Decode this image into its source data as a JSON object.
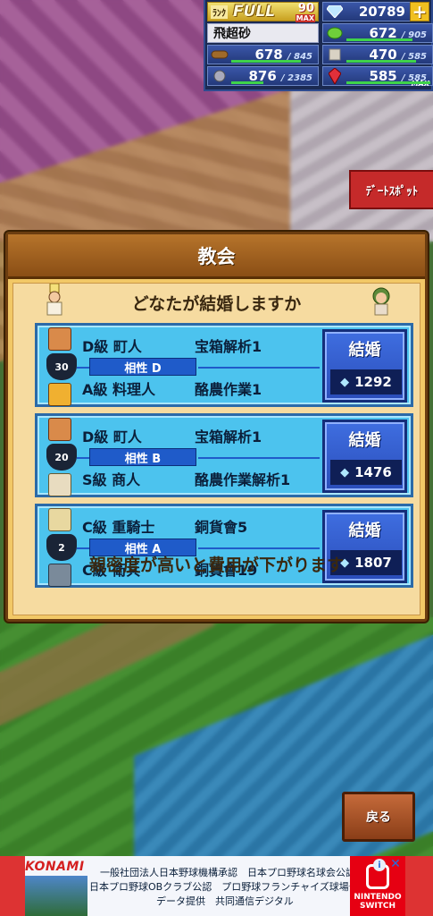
{
  "status": {
    "rank_label": "ﾗﾝｸ",
    "rank_full": "FULL",
    "rank_level": "90",
    "rank_max": "MAX",
    "gems": "20789",
    "town_name": "飛超砂",
    "resources": [
      {
        "icon": "grass-icon",
        "value": "672",
        "max": "905",
        "fill": 0.74
      },
      {
        "icon": "wood-icon",
        "value": "678",
        "max": "845",
        "fill": 0.8
      },
      {
        "icon": "food-icon",
        "value": "470",
        "max": "585",
        "fill": 0.8
      },
      {
        "icon": "ore-icon",
        "value": "876",
        "max": "2385",
        "fill": 0.37
      },
      {
        "icon": "ruby-icon",
        "value": "585",
        "max": "585",
        "fill": 1.0
      }
    ],
    "ruby_max_label": "MAX",
    "colors": {
      "bar": "#3fd34a",
      "panel": "#1b2a52"
    }
  },
  "date_spot": "ﾃﾞｰﾄｽﾎﾟｯﾄ",
  "dialog": {
    "title": "教会",
    "question": "どなたが結婚しますか",
    "hint": "親密度が高いと費用が下がります",
    "couples": [
      {
        "person1": {
          "rank": "D級",
          "job": "町人",
          "skill": "宝箱解析1"
        },
        "person2": {
          "rank": "A級",
          "job": "料理人",
          "skill": "酪農作業1"
        },
        "intimacy": "30",
        "compat": "相性 D",
        "button": "結婚",
        "cost": "1292"
      },
      {
        "person1": {
          "rank": "D級",
          "job": "町人",
          "skill": "宝箱解析1"
        },
        "person2": {
          "rank": "S級",
          "job": "商人",
          "skill": "酪農作業解析1"
        },
        "intimacy": "20",
        "compat": "相性 B",
        "button": "結婚",
        "cost": "1476"
      },
      {
        "person1": {
          "rank": "C級",
          "job": "重騎士",
          "skill": "銅貨會5"
        },
        "person2": {
          "rank": "C級",
          "job": "衛兵",
          "skill": "銅貨會19"
        },
        "intimacy": "2",
        "compat": "相性 A",
        "button": "結婚",
        "cost": "1807"
      }
    ]
  },
  "back_button": "戻る",
  "ad": {
    "brand": "KONAMI",
    "line1": "一般社団法人日本野球機構承認　日本プロ野球名球会公認",
    "line2": "日本プロ野球OBクラブ公認　プロ野球フランチャイズ球場公認",
    "line3": "データ提供　共同通信デジタル",
    "platform1": "NINTENDO",
    "platform2": "SWITCH"
  }
}
